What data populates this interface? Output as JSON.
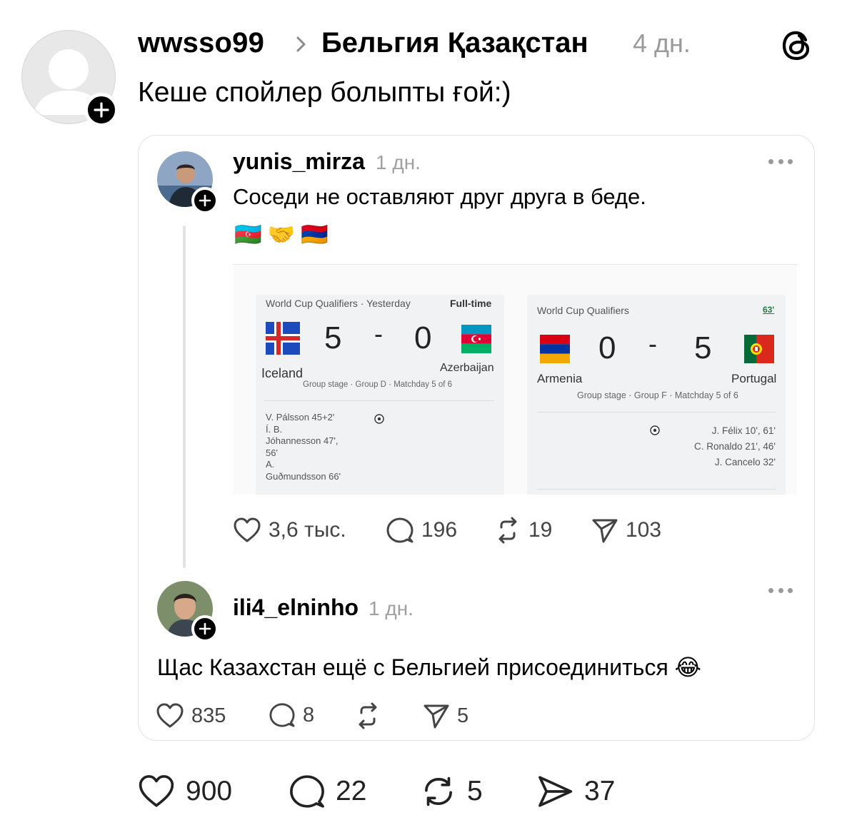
{
  "post": {
    "username": "wwsso99",
    "community": "Бельгия Қазақстан",
    "time": "4 дн.",
    "text": "Кеше спойлер болыпты ғой:)",
    "likes": "900",
    "comments": "22",
    "reposts": "5",
    "shares": "37"
  },
  "quoted": {
    "username": "yunis_mirza",
    "time": "1 дн.",
    "text": "Соседи не оставляют друг друга в беде.",
    "emojis": [
      "🇦🇿",
      "🤝",
      "🇦🇲"
    ],
    "likes": "3,6 тыс.",
    "comments": "196",
    "reposts": "19",
    "shares": "103"
  },
  "scores": {
    "left": {
      "header": "World Cup Qualifiers · Yesterday",
      "status": "Full-time",
      "home_team": "Iceland",
      "away_team": "Azerbaijan",
      "home_score": "5",
      "away_score": "0",
      "dash": "-",
      "stage": "Group stage · Group D · Matchday 5 of 6",
      "scorers": [
        "V. Pálsson 45+2'",
        "Í. B.",
        "Jóhannesson 47',",
        "56'",
        "A.",
        "Guðmundsson 66'"
      ]
    },
    "right": {
      "header": "World Cup Qualifiers",
      "status": "63'",
      "home_team": "Armenia",
      "away_team": "Portugal",
      "home_score": "0",
      "away_score": "5",
      "dash": "-",
      "stage": "Group stage · Group F · Matchday 5 of 6",
      "scorers": [
        "J. Félix 10', 61'",
        "C. Ronaldo 21', 46'",
        "J. Cancelo 32'"
      ]
    }
  },
  "reply": {
    "username": "ili4_elninho",
    "time": "1 дн.",
    "text": "Щас Казахстан ещё с Бельгией присоединиться 😂",
    "likes": "835",
    "comments": "8",
    "shares": "5"
  },
  "icons": {
    "threads": "threads-logo-icon",
    "heart": "heart-icon",
    "comment": "comment-bubble-icon",
    "repost": "repost-icon",
    "share": "send-icon"
  }
}
